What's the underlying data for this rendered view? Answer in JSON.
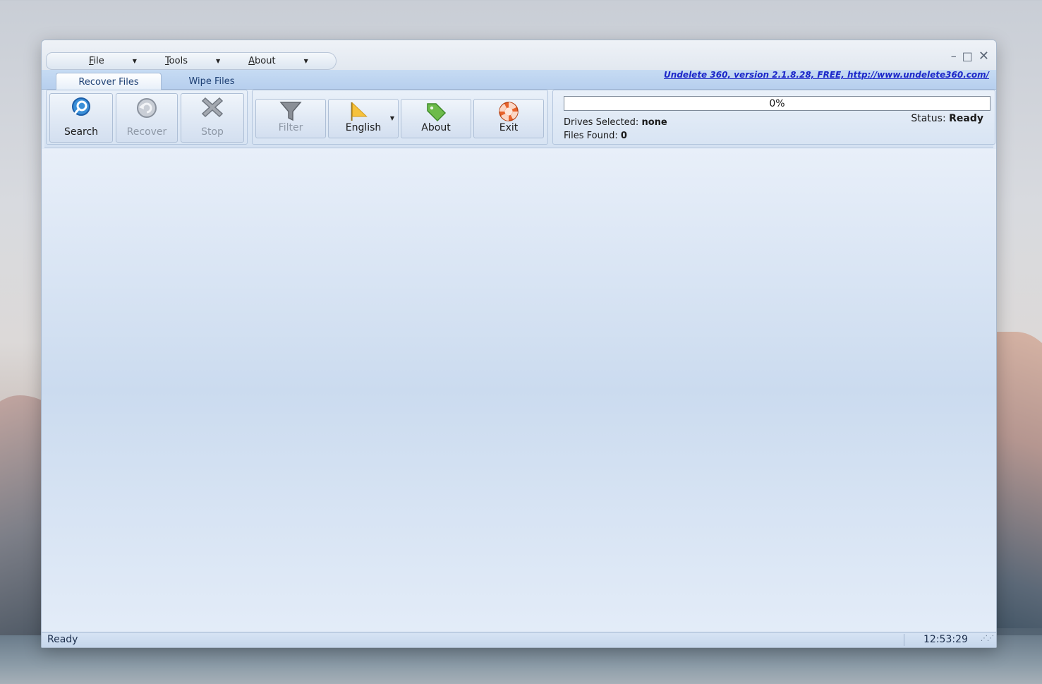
{
  "menu": {
    "items": [
      {
        "label": "File"
      },
      {
        "label": "Tools"
      },
      {
        "label": "About"
      }
    ]
  },
  "window_controls": {
    "minimize": "–",
    "maximize": "□",
    "close": "✕"
  },
  "tabs": [
    {
      "label": "Recover Files",
      "active": true
    },
    {
      "label": "Wipe Files",
      "active": false
    }
  ],
  "version_link": "Undelete 360, version 2.1.8.28, FREE, http://www.undelete360.com/",
  "toolbar": {
    "search": "Search",
    "recover": "Recover",
    "stop": "Stop",
    "filter": "Filter",
    "language": "English",
    "about": "About",
    "exit": "Exit"
  },
  "status_panel": {
    "progress_text": "0%",
    "progress_value": 0,
    "drives_label": "Drives Selected:",
    "drives_value": "none",
    "files_label": "Files Found:",
    "files_value": "0",
    "status_label": "Status:",
    "status_value": "Ready"
  },
  "statusbar": {
    "text": "Ready",
    "time": "12:53:29"
  },
  "icons": {
    "search": "magnifier-icon",
    "recover": "recover-arrow-icon",
    "stop": "x-stop-icon",
    "filter": "funnel-icon",
    "language": "flag-icon",
    "about": "tag-icon",
    "exit": "lifebuoy-icon"
  },
  "colors": {
    "accent": "#1b27c9",
    "ribbon": "#d5e2f2",
    "exit_icon": "#e8632b"
  }
}
